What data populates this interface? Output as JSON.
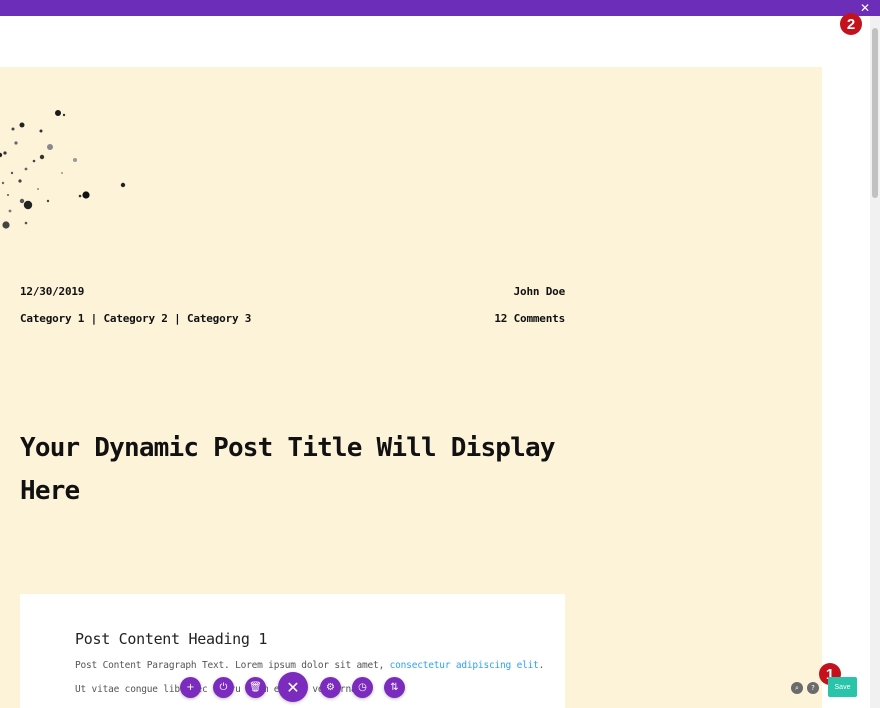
{
  "top_bar": {
    "close_glyph": "✕",
    "color": "#6c2eb9"
  },
  "post": {
    "date": "12/30/2019",
    "author": "John Doe",
    "categories": "Category 1 | Category 2 | Category 3",
    "comments": "12 Comments",
    "title": "Your Dynamic Post Title Will Display Here"
  },
  "content": {
    "heading": "Post Content Heading 1",
    "paragraph_start": "Post Content Paragraph Text. Lorem ipsum dolor sit amet, ",
    "paragraph_link": "consectetur adipiscing elit",
    "paragraph_end": ".",
    "paragraph2": "Ut vitae congue liber  ec    bu  ru    ib   m  e   as   i vel ornare"
  },
  "toolbar": {
    "buttons": [
      {
        "name": "add-icon",
        "glyph": "+"
      },
      {
        "name": "power-icon",
        "glyph": "⏻"
      },
      {
        "name": "trash-icon",
        "glyph": "🗑"
      },
      {
        "name": "close-icon",
        "glyph": "✕"
      },
      {
        "name": "gear-icon",
        "glyph": "⚙"
      },
      {
        "name": "history-icon",
        "glyph": "◷"
      },
      {
        "name": "sort-icon",
        "glyph": "⇅"
      }
    ]
  },
  "markers": {
    "one": "1",
    "two": "2"
  },
  "bottom_controls": {
    "search_glyph": "⌕",
    "help_glyph": "?",
    "save_label": "Save"
  },
  "colors": {
    "canvas_bg": "#fdf3d9",
    "accent": "#7b2cbf",
    "link": "#2ea3f2",
    "save": "#29c4a9",
    "marker": "#c4111b"
  }
}
